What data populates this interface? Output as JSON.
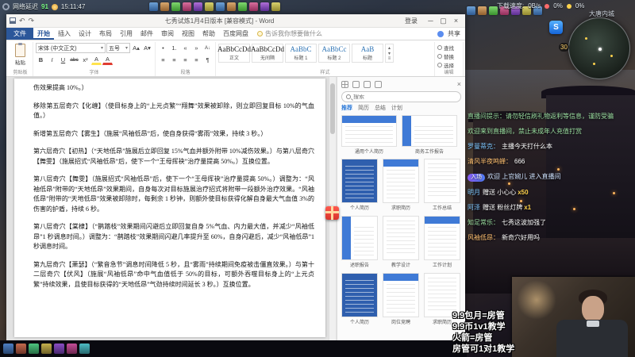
{
  "colors": {
    "word_accent_blue": "#2b579a",
    "template_blue": "#3f7ad6",
    "chat_name_blue": "#7ec7ff",
    "chat_name_orange": "#ffc071",
    "chat_system_green": "#9ce0a2",
    "gift_count_yellow": "#ffd34d",
    "latency_green": "#7dff8a"
  },
  "stream": {
    "latency_label": "网络延迟",
    "latency_value": "91",
    "time": "15:11:47",
    "download_label": "下载速度:",
    "download_value": "0B/s",
    "stat_cpu": "0%",
    "stat_mem": "0%",
    "location": "大唐内城",
    "minimap_level": "30",
    "map_logo": "S",
    "promo_lines": [
      "9.9包月=房管",
      "9.9币1v1教学",
      "火箭=房管",
      "房管可1对1教学"
    ]
  },
  "word": {
    "title": "七秀试炼1月4日版本 [兼容模式] - Word",
    "login": "登录",
    "share": "共享",
    "tell_me": "告诉我你想要做什么",
    "tabs": [
      "文件",
      "开始",
      "插入",
      "设计",
      "布局",
      "引用",
      "邮件",
      "审阅",
      "视图",
      "帮助",
      "百度网盘"
    ],
    "paste_label": "粘贴",
    "group_labels": [
      "剪贴板",
      "字体",
      "段落",
      "样式",
      "编辑"
    ],
    "font_controls": {
      "name": "宋体 (中文正文)",
      "size": "五号",
      "buttons": [
        "B",
        "I",
        "U",
        "abc",
        "x²",
        "A",
        "A"
      ]
    },
    "styles": [
      {
        "sample": "AaBbCcDd",
        "label": "正文"
      },
      {
        "sample": "AaBbCcDd",
        "label": "无间隔"
      },
      {
        "sample": "AaBbC",
        "label": "标题 1"
      },
      {
        "sample": "AaBbCc",
        "label": "标题 2"
      },
      {
        "sample": "AaB",
        "label": "标题"
      }
    ],
    "edit_items": [
      "查找",
      "替换",
      "选择"
    ],
    "paragraphs": [
      "伤效果提高 10%。）",
      "移除第五层奇穴【化缠】（使目标身上的“上元贞繁”“翔舞”效果被卸除，则立即回复目标 10%的气血值。）",
      "新增第五层奇穴【雾生】（施展“风袖低昂”后，使自身获得“雾雨”效果，持续 3 秒。）",
      "第六层奇穴【初热】（“天地低昂”施展后立即回复 15%气血并额外附带 10%减伤效果。）与第八层奇穴【舞雯】（施展招式“风袖低昂”后，使下一个“王母挥袂”治疗量提高 50%。）互换位置。",
      "第八层奇穴【舞雯】（施展招式“风袖低昂”后，使下一个“王母挥袂”治疗量提高 50%。）调整为：“风袖低昂”附带的“天地低昂”效果期间，自身每次对目标施展治疗招式将附带一段额外治疗效果。“风袖低昂”附带的“天地低昂”效果被卸除时，每剩余 1 秒钟，则额外使目标获得化解自身最大气血值 3%的伤害的护盾，持续 6 秒。",
      "第八层奇穴【棠棣】（“鹊踏枝”效果期间闪避后立即回复自身 5%气血、内力最大值，并减少“风袖低昂”1 秒调息时间。）调整为：“鹊踏枝”效果期间闪避几率提升至 60%，自身闪避后，减少“风袖低昂”1 秒调息时间。",
      "第九层奇穴【萧瑟】（“繁音急节”调息时间降低 5 秒，且“雾雨”持续期间免疫被击僵直效果。）与第十二层奇穴【伏风】（施展“风袖低昂”命中气血值低于 50%的目标，可额外吞噬目标身上的“上元贞繁”持续效果，且使目标获得的“天地低昂”气劲持续时间延长 3 秒。）互换位置。"
    ],
    "task_pane": {
      "search_placeholder": "搜索",
      "filters": [
        "推荐",
        "简历",
        "总结",
        "计划"
      ],
      "wide_cards": [
        {
          "label": "通用个人简历"
        },
        {
          "label": "商务工作报告"
        }
      ],
      "cards": [
        {
          "label": "个人简历"
        },
        {
          "label": "求职简历"
        },
        {
          "label": "工作总结"
        },
        {
          "label": "述职报告"
        },
        {
          "label": "教学设计"
        },
        {
          "label": "工作计划"
        },
        {
          "label": "个人简历"
        },
        {
          "label": "岗位竞聘"
        },
        {
          "label": "求职简历"
        }
      ]
    }
  },
  "game": {
    "chat": [
      {
        "type": "system",
        "text": "直播间提示：请勿轻信刷礼物返利等信息，谨防受骗"
      },
      {
        "type": "system",
        "text": "欢迎来到直播间，禁止未成年人充值打赏"
      },
      {
        "type": "user",
        "name": "罗曼蒂克：",
        "text": "主播今天打什么本"
      },
      {
        "type": "user",
        "name": "清风半夜鸣蝉：",
        "text": "666"
      },
      {
        "type": "enter",
        "badge": "入场",
        "text": "欢迎 上官婉儿 进入直播间"
      },
      {
        "type": "gift",
        "name": "明月",
        "text": "赠送 小心心",
        "count": "x50"
      },
      {
        "type": "gift",
        "name": "阿泽",
        "text": "赠送 粉丝灯牌",
        "count": "x1"
      },
      {
        "type": "user",
        "name": "知足常乐：",
        "text": "七秀这波加强了"
      },
      {
        "type": "user",
        "name": "风袖低昂：",
        "text": "新奇穴好用吗"
      }
    ]
  }
}
